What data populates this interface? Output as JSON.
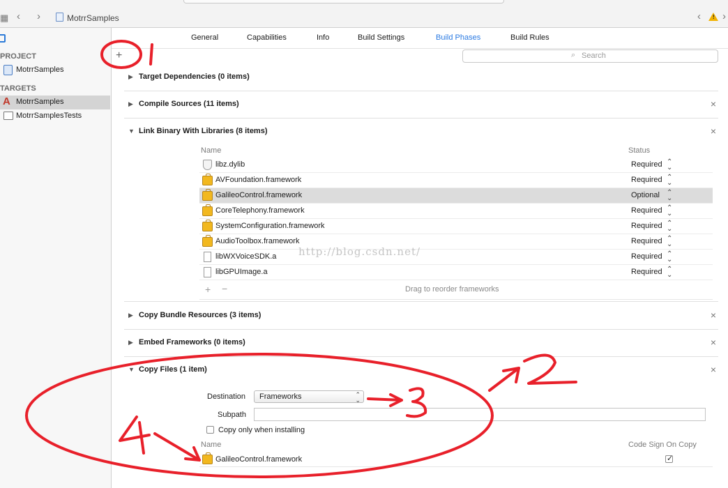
{
  "toolbar": {
    "breadcrumb": "MotrrSamples",
    "icons": [
      "grid-icon",
      "back-icon",
      "forward-icon",
      "file-icon",
      "warning-icon"
    ]
  },
  "tabs": [
    {
      "label": "General",
      "active": false
    },
    {
      "label": "Capabilities",
      "active": false
    },
    {
      "label": "Info",
      "active": false
    },
    {
      "label": "Build Settings",
      "active": false
    },
    {
      "label": "Build Phases",
      "active": true
    },
    {
      "label": "Build Rules",
      "active": false
    }
  ],
  "sidebar": {
    "project_header": "PROJECT",
    "project_item": "MotrrSamples",
    "targets_header": "TARGETS",
    "targets": [
      {
        "label": "MotrrSamples",
        "selected": true
      },
      {
        "label": "MotrrSamplesTests",
        "selected": false
      }
    ]
  },
  "filter": {
    "add_label": "+",
    "search_placeholder": "Search"
  },
  "phases": {
    "target_dependencies": "Target Dependencies (0 items)",
    "compile_sources": "Compile Sources (11 items)",
    "link_binary": "Link Binary With Libraries (8 items)",
    "copy_bundle": "Copy Bundle Resources (3 items)",
    "embed_frameworks": "Embed Frameworks (0 items)",
    "copy_files": "Copy Files (1 item)",
    "close_glyph": "×"
  },
  "libraries": {
    "col_name": "Name",
    "col_status": "Status",
    "rows": [
      {
        "name": "libz.dylib",
        "status": "Required",
        "icon": "dylib-icon"
      },
      {
        "name": "AVFoundation.framework",
        "status": "Required",
        "icon": "framework-icon"
      },
      {
        "name": "GalileoControl.framework",
        "status": "Optional",
        "icon": "framework-icon"
      },
      {
        "name": "CoreTelephony.framework",
        "status": "Required",
        "icon": "framework-icon"
      },
      {
        "name": "SystemConfiguration.framework",
        "status": "Required",
        "icon": "framework-icon"
      },
      {
        "name": "AudioToolbox.framework",
        "status": "Required",
        "icon": "framework-icon"
      },
      {
        "name": "libWXVoiceSDK.a",
        "status": "Required",
        "icon": "file-icon"
      },
      {
        "name": "libGPUImage.a",
        "status": "Required",
        "icon": "file-icon"
      }
    ],
    "footer_hint": "Drag to reorder frameworks",
    "add_label": "+",
    "remove_label": "−"
  },
  "watermark": "http://blog.csdn.net/",
  "copy_files": {
    "destination_label": "Destination",
    "destination_value": "Frameworks",
    "subpath_label": "Subpath",
    "subpath_value": "",
    "copy_only_label": "Copy only when installing",
    "copy_only_checked": false,
    "col_name": "Name",
    "col_codesign": "Code Sign On Copy",
    "rows": [
      {
        "name": "GalileoControl.framework",
        "code_sign": true
      }
    ]
  },
  "annotations": {
    "one": "1",
    "two": "2",
    "three": "3",
    "four": "4",
    "color": "#e8202a"
  }
}
